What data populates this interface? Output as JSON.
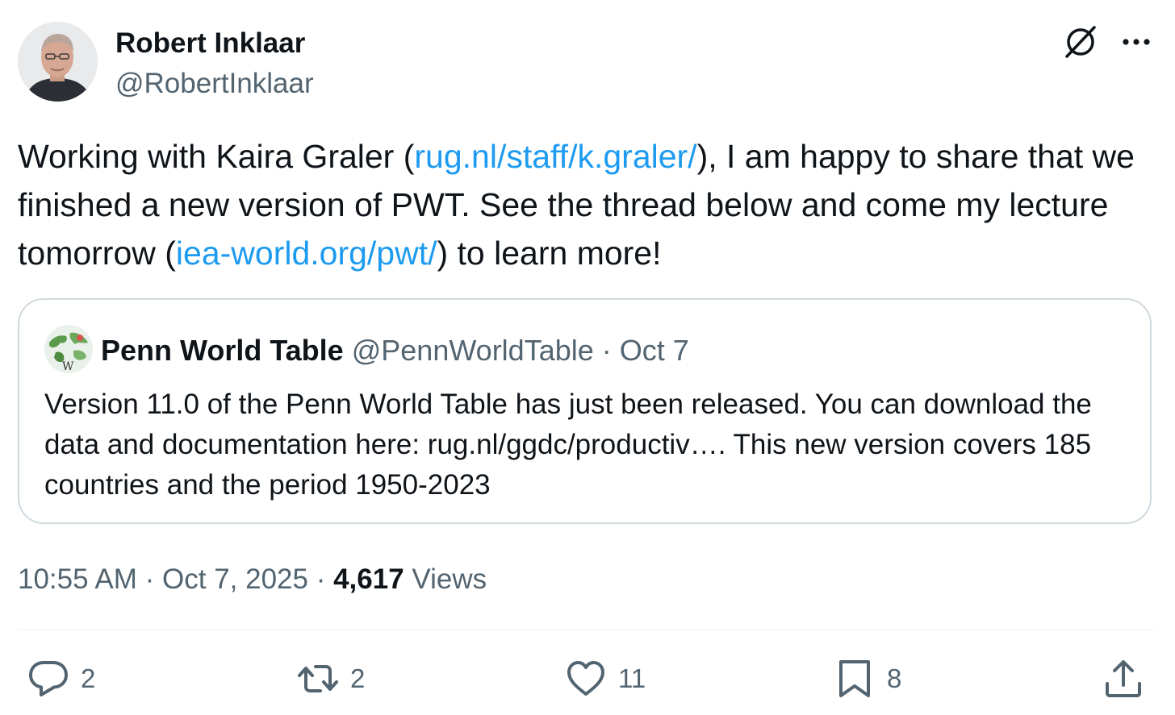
{
  "author": {
    "name": "Robert Inklaar",
    "handle": "@RobertInklaar",
    "avatar_icon": "profile-photo"
  },
  "tweet": {
    "text_1": "Working with Kaira Graler (",
    "link_1": "rug.nl/staff/k.graler/",
    "text_2": "), I am happy to share that we finished a new version of PWT. See the thread below and come my lecture tomorrow (",
    "link_2": "iea-world.org/pwt/",
    "text_3": ") to learn more!"
  },
  "quote": {
    "name": "Penn World Table",
    "handle": "@PennWorldTable",
    "separator": "·",
    "date": "Oct 7",
    "text": "Version 11.0 of the Penn World Table has just been released. You can download the data and documentation here: rug.nl/ggdc/productiv…. This new version covers 185 countries and the period 1950-2023"
  },
  "meta": {
    "time": "10:55 AM",
    "separator_1": "·",
    "date": "Oct 7, 2025",
    "separator_2": "·",
    "views_count": "4,617",
    "views_label": "Views"
  },
  "actions": {
    "replies": "2",
    "reposts": "2",
    "likes": "11",
    "bookmarks": "8"
  },
  "icons": {
    "top": [
      "grok-icon",
      "more-icon"
    ],
    "actions": [
      "reply-icon",
      "repost-icon",
      "like-icon",
      "bookmark-icon",
      "share-icon"
    ]
  },
  "colors": {
    "link": "#1d9bf0",
    "text": "#0f1419",
    "secondary": "#536471",
    "border": "#cfd9de"
  }
}
